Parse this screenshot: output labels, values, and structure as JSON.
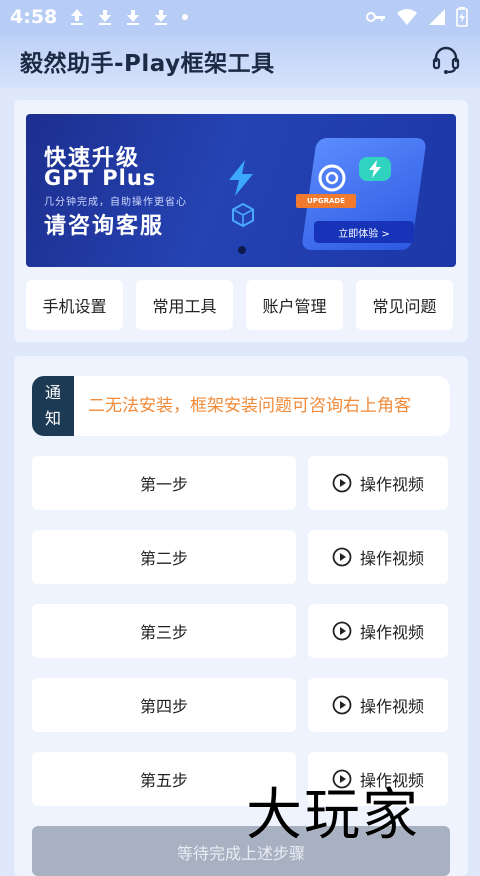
{
  "status_bar": {
    "time": "4:58",
    "left_icons": [
      "upload-icon",
      "download-icon",
      "download-icon",
      "download-icon",
      "dot-icon"
    ],
    "right_icons": [
      "vpn-key-icon",
      "wifi-icon",
      "signal-icon",
      "battery-icon"
    ]
  },
  "app_bar": {
    "title": "毅然助手-Play框架工具",
    "support_icon": "headset-icon"
  },
  "banner": {
    "line1": "快速升级",
    "line2": "GPT Plus",
    "line3": "几分钟完成，自助操作更省心",
    "line4": "请咨询客服",
    "upgrade_label": "UPGRADE",
    "try_label": "立即体验 >"
  },
  "menu": [
    {
      "label": "手机设置"
    },
    {
      "label": "常用工具"
    },
    {
      "label": "账户管理"
    },
    {
      "label": "常见问题"
    }
  ],
  "notice": {
    "tag_line1": "通",
    "tag_line2": "知",
    "text": "二无法安装，框架安装问题可咨询右上角客"
  },
  "steps": [
    {
      "label": "第一步",
      "video_label": "操作视频"
    },
    {
      "label": "第二步",
      "video_label": "操作视频"
    },
    {
      "label": "第三步",
      "video_label": "操作视频"
    },
    {
      "label": "第四步",
      "video_label": "操作视频"
    },
    {
      "label": "第五步",
      "video_label": "操作视频"
    }
  ],
  "wait_button": {
    "label": "等待完成上述步骤"
  },
  "watermark": {
    "text": "大玩家"
  },
  "colors": {
    "accent_orange": "#f08b3a",
    "notice_tag": "#1d3a55",
    "banner_blue": "#2543b3",
    "background": "#dfe8fb"
  }
}
